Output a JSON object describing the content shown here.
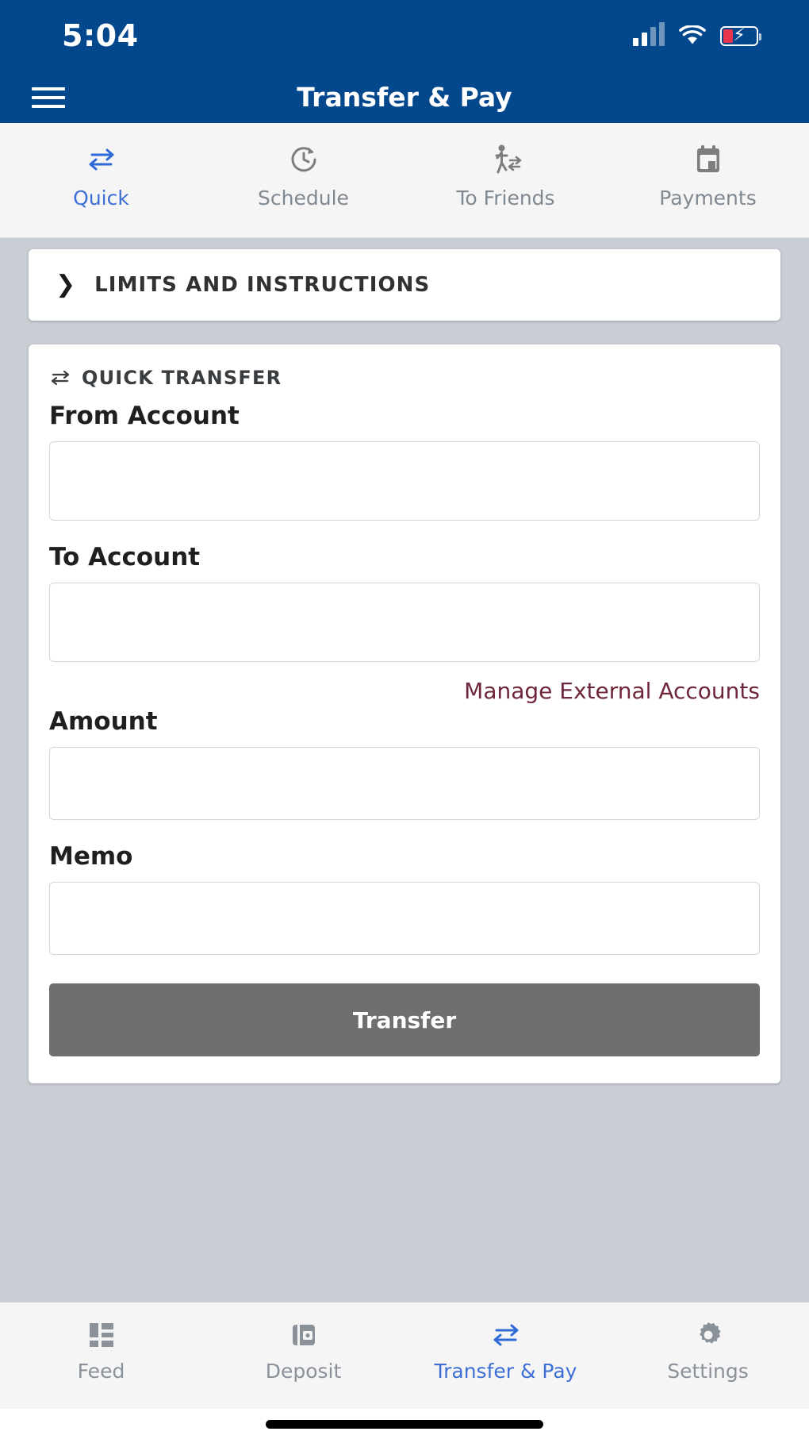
{
  "status_bar": {
    "time": "5:04",
    "signal_icon": "cellular-signal-icon",
    "wifi_icon": "wifi-icon",
    "battery_icon": "battery-charging-icon"
  },
  "header": {
    "menu_icon": "hamburger-menu-icon",
    "title": "Transfer & Pay",
    "background_color": "#03488d"
  },
  "segment_tabs": {
    "items": [
      {
        "label": "Quick",
        "icon": "transfer-arrows-icon",
        "active": true
      },
      {
        "label": "Schedule",
        "icon": "clock-refresh-icon",
        "active": false
      },
      {
        "label": "To Friends",
        "icon": "person-transfer-icon",
        "active": false
      },
      {
        "label": "Payments",
        "icon": "calendar-icon",
        "active": false
      }
    ],
    "active_color": "#3d6fd6",
    "inactive_color": "#808890"
  },
  "limits_card": {
    "chevron_icon": "chevron-right-icon",
    "title": "LIMITS AND INSTRUCTIONS"
  },
  "quick_transfer": {
    "section_icon": "transfer-arrows-icon",
    "section_title": "QUICK TRANSFER",
    "fields": [
      {
        "label": "From Account",
        "value": "",
        "placeholder": ""
      },
      {
        "label": "To Account",
        "value": "",
        "placeholder": ""
      },
      {
        "label": "Amount",
        "value": "",
        "placeholder": ""
      },
      {
        "label": "Memo",
        "value": "",
        "placeholder": ""
      }
    ],
    "external_link": "Manage External Accounts",
    "external_link_color": "#6e2739",
    "submit_label": "Transfer",
    "submit_color": "#6f6f6f"
  },
  "bottom_nav": {
    "items": [
      {
        "label": "Feed",
        "icon": "dashboard-grid-icon",
        "active": false
      },
      {
        "label": "Deposit",
        "icon": "wallet-icon",
        "active": false
      },
      {
        "label": "Transfer & Pay",
        "icon": "transfer-arrows-icon",
        "active": true
      },
      {
        "label": "Settings",
        "icon": "gear-icon",
        "active": false
      }
    ],
    "active_color": "#3d6fd6",
    "inactive_color": "#8a9199"
  }
}
